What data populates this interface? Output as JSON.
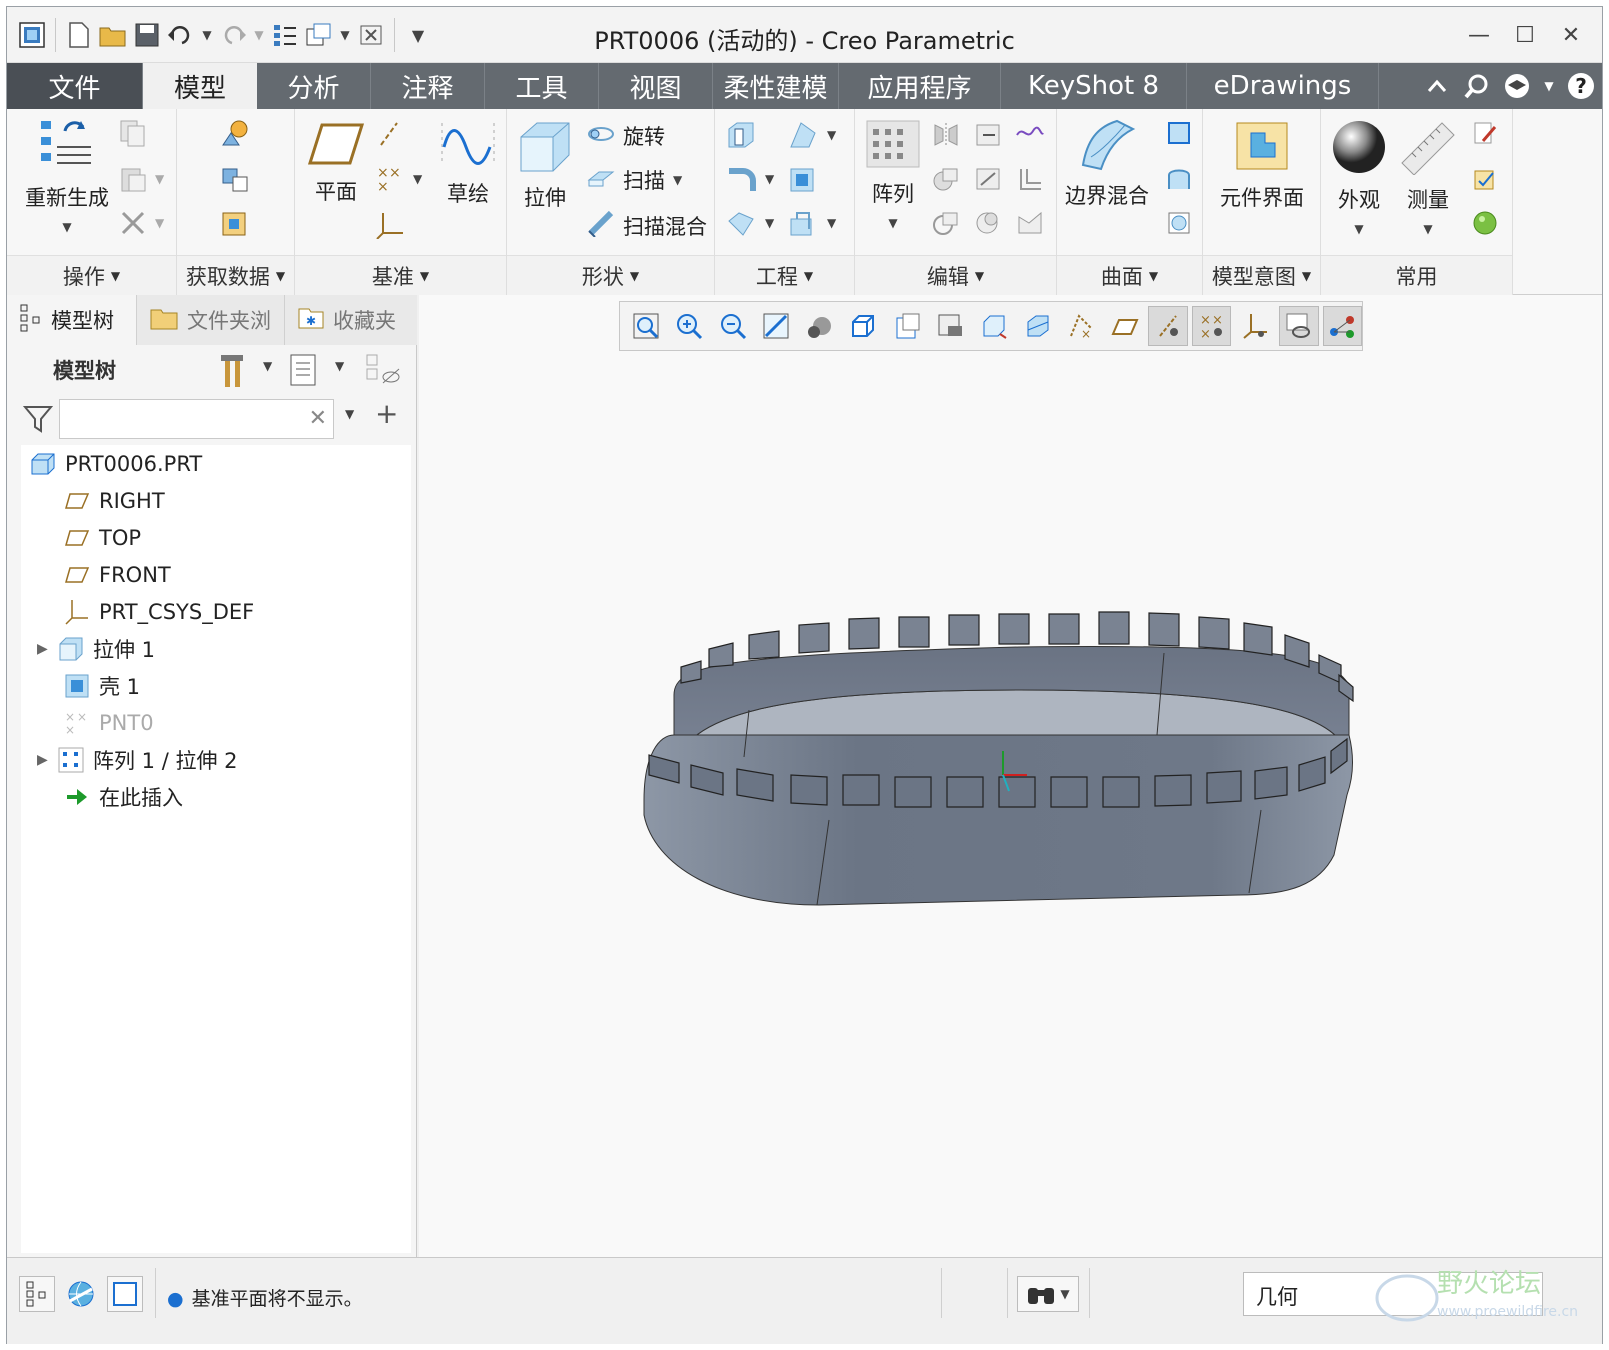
{
  "window": {
    "title": "PRT0006 (活动的) - Creo Parametric",
    "minimize": "—",
    "maximize": "☐",
    "close": "✕"
  },
  "menu_tabs": [
    {
      "label": "文件"
    },
    {
      "label": "模型"
    },
    {
      "label": "分析"
    },
    {
      "label": "注释"
    },
    {
      "label": "工具"
    },
    {
      "label": "视图"
    },
    {
      "label": "柔性建模"
    },
    {
      "label": "应用程序"
    },
    {
      "label": "KeyShot 8"
    },
    {
      "label": "eDrawings"
    }
  ],
  "ribbon": {
    "groups": {
      "operations": "操作",
      "get_data": "获取数据",
      "datum": "基准",
      "shapes": "形状",
      "engineering": "工程",
      "editing": "编辑",
      "surfaces": "曲面",
      "model_intent": "模型意图",
      "common": "常用"
    },
    "buttons": {
      "regenerate": "重新生成",
      "plane": "平面",
      "sketch": "草绘",
      "extrude": "拉伸",
      "revolve": "旋转",
      "sweep": "扫描",
      "swept_blend": "扫描混合",
      "pattern": "阵列",
      "boundary_blend": "边界混合",
      "component_interface": "元件界面",
      "appearance": "外观",
      "measure": "测量"
    }
  },
  "left_panel": {
    "tabs": [
      {
        "label": "模型树"
      },
      {
        "label": "文件夹浏"
      },
      {
        "label": "收藏夹"
      }
    ],
    "header": "模型树",
    "search": {
      "value": "",
      "placeholder": ""
    },
    "tree": [
      {
        "label": "PRT0006.PRT",
        "icon": "part-icon"
      },
      {
        "label": "RIGHT",
        "icon": "datum-plane-icon"
      },
      {
        "label": "TOP",
        "icon": "datum-plane-icon"
      },
      {
        "label": "FRONT",
        "icon": "datum-plane-icon"
      },
      {
        "label": "PRT_CSYS_DEF",
        "icon": "csys-icon"
      },
      {
        "label": "拉伸 1",
        "icon": "extrude-icon"
      },
      {
        "label": "壳 1",
        "icon": "shell-icon"
      },
      {
        "label": "PNT0",
        "icon": "datum-point-icon"
      },
      {
        "label": "阵列 1 / 拉伸 2",
        "icon": "pattern-icon"
      },
      {
        "label": "在此插入",
        "icon": "insert-here-icon"
      }
    ]
  },
  "status": {
    "message": "基准平面将不显示。",
    "filter": "几何"
  },
  "colors": {
    "tab_bar": "#646a70",
    "file_tab": "#4a4f55",
    "model_surface": "#6b7585",
    "model_highlight": "#8d97a6"
  }
}
